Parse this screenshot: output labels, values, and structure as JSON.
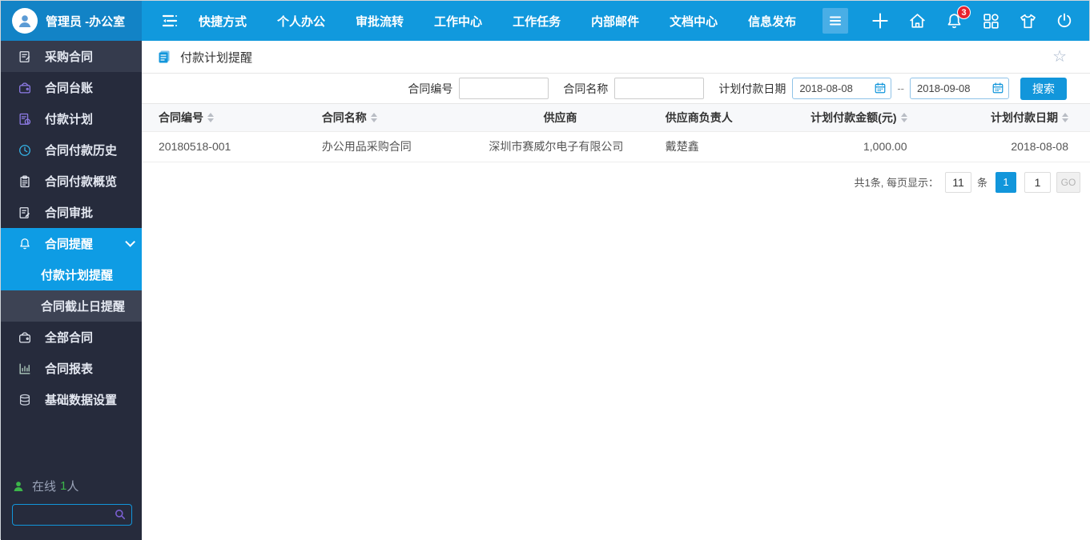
{
  "header": {
    "user": {
      "name": "管理员 -办公室"
    },
    "nav_items": [
      "快捷方式",
      "个人办公",
      "审批流转",
      "工作中心",
      "工作任务",
      "内部邮件",
      "文档中心",
      "信息发布"
    ],
    "notification_count": "3"
  },
  "sidebar": {
    "items": [
      {
        "label": "采购合同",
        "icon": "doc-edit",
        "group": true,
        "icon_color": "#E4E8F1"
      },
      {
        "label": "合同台账",
        "icon": "wallet",
        "icon_color": "#8F7CE8"
      },
      {
        "label": "付款计划",
        "icon": "doc-clock",
        "icon_color": "#8F7CE8"
      },
      {
        "label": "合同付款历史",
        "icon": "clock",
        "icon_color": "#35B6E9"
      },
      {
        "label": "合同付款概览",
        "icon": "clipboard",
        "icon_color": "#E4E8F1"
      },
      {
        "label": "合同审批",
        "icon": "doc-pen",
        "icon_color": "#E4E8F1"
      },
      {
        "label": "合同提醒",
        "icon": "bell",
        "active": true,
        "expandable": true,
        "icon_color": "#FFFFFF"
      },
      {
        "label": "付款计划提醒",
        "sub": true,
        "active": true
      },
      {
        "label": "合同截止日提醒",
        "sub": true,
        "bg": "#3D4354"
      },
      {
        "label": "全部合同",
        "icon": "wallet",
        "icon_color": "#E4E8F1"
      },
      {
        "label": "合同报表",
        "icon": "chart",
        "icon_color": "#BBD9C9"
      },
      {
        "label": "基础数据设置",
        "icon": "database",
        "icon_color": "#C9CFDB"
      }
    ],
    "online": {
      "prefix": "在线",
      "count": "1",
      "suffix": "人"
    },
    "search_placeholder": ""
  },
  "page": {
    "title": "付款计划提醒"
  },
  "filters": {
    "contract_no_label": "合同编号",
    "contract_no_value": "",
    "contract_name_label": "合同名称",
    "contract_name_value": "",
    "pay_date_label": "计划付款日期",
    "date_from": "2018-08-08",
    "date_to": "2018-09-08",
    "range_separator": "--",
    "search_label": "搜索"
  },
  "table": {
    "columns": [
      {
        "label": "合同编号",
        "sortable": true
      },
      {
        "label": "合同名称",
        "sortable": true
      },
      {
        "label": "供应商",
        "sortable": false
      },
      {
        "label": "供应商负责人",
        "sortable": false
      },
      {
        "label": "计划付款金额(元)",
        "sortable": true
      },
      {
        "label": "计划付款日期",
        "sortable": true
      }
    ],
    "rows": [
      [
        "20180518-001",
        "办公用品采购合同",
        "深圳市赛威尔电子有限公司",
        "戴楚鑫",
        "1,000.00",
        "2018-08-08"
      ]
    ]
  },
  "pagination": {
    "summary": "共1条, 每页显示：",
    "page_size": "11",
    "unit": "条",
    "current_page": "1",
    "goto_value": "1",
    "go_label": "GO"
  },
  "colors": {
    "header_blue": "#1199DD",
    "user_block_blue": "#1283C6",
    "sidebar_dark": "#262B3C",
    "active_blue": "#0E9CE4",
    "accent_blue": "#1296DB",
    "overdue_red": "#E60000",
    "online_green": "#3CB54A",
    "badge_red": "#E8212D"
  }
}
